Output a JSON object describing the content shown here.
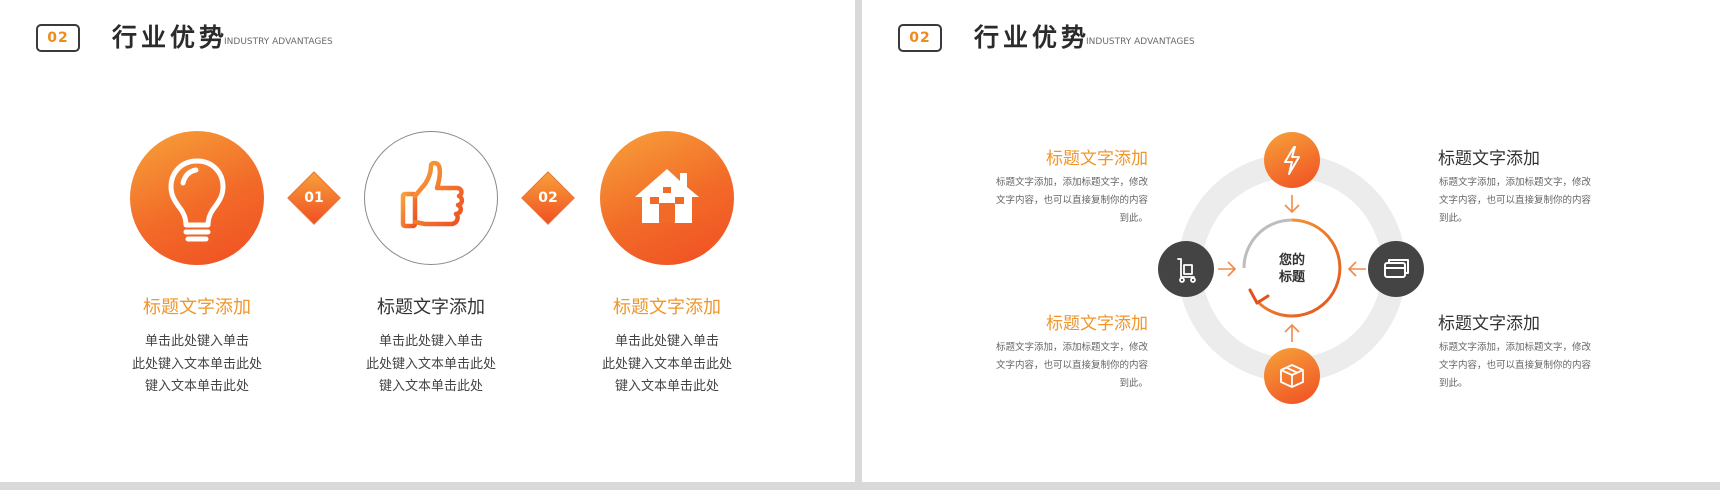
{
  "left_slide": {
    "badge": "02",
    "title": "行业优势",
    "subtitle": "INDUSTRY ADVANTAGES",
    "features": [
      {
        "icon": "lightbulb-icon",
        "title": "标题文字添加",
        "lines": [
          "单击此处键入单击",
          "此处键入文本单击此处",
          "键入文本单击此处"
        ]
      },
      {
        "icon": "thumbs-up-icon",
        "title": "标题文字添加",
        "lines": [
          "单击此处键入单击",
          "此处键入文本单击此处",
          "键入文本单击此处"
        ]
      },
      {
        "icon": "house-icon",
        "title": "标题文字添加",
        "lines": [
          "单击此处键入单击",
          "此处键入文本单击此处",
          "键入文本单击此处"
        ]
      }
    ],
    "steps": [
      "01",
      "02"
    ]
  },
  "right_slide": {
    "badge": "02",
    "title": "行业优势",
    "subtitle": "INDUSTRY ADVANTAGES",
    "center": {
      "line1": "您的",
      "line2": "标题"
    },
    "blocks": [
      {
        "title": "标题文字添加",
        "lines": [
          "标题文字添加，添加标题文字，修改",
          "文字内容，也可以直接复制你的内容",
          "到此。"
        ]
      },
      {
        "title": "标题文字添加",
        "lines": [
          "标题文字添加，添加标题文字，修改",
          "文字内容，也可以直接复制你的内容",
          "到此。"
        ]
      },
      {
        "title": "标题文字添加",
        "lines": [
          "标题文字添加，添加标题文字，修改",
          "文字内容，也可以直接复制你的内容",
          "到此。"
        ]
      },
      {
        "title": "标题文字添加",
        "lines": [
          "标题文字添加，添加标题文字，修改",
          "文字内容，也可以直接复制你的内容",
          "到此。"
        ]
      }
    ],
    "nodes": [
      "lightning-icon",
      "card-icon",
      "box-icon",
      "cart-icon"
    ]
  },
  "colors": {
    "accent": "#f0962a",
    "accent_deep": "#f04e23",
    "dark": "#444444",
    "ring": "#ececec"
  }
}
